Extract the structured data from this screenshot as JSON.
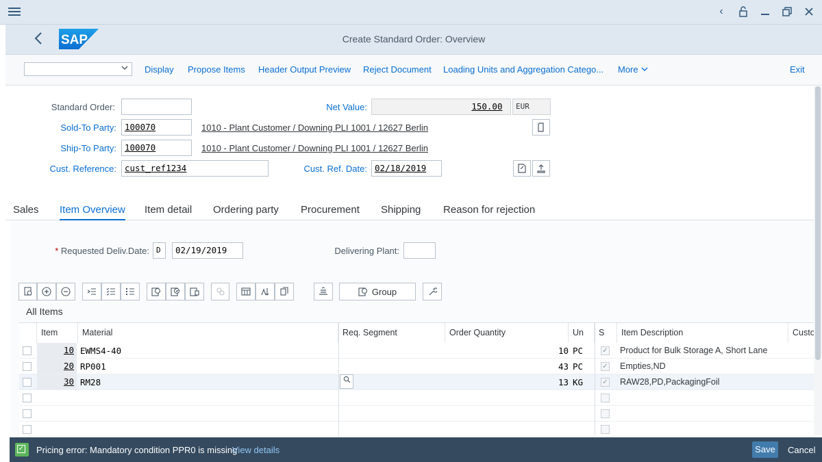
{
  "window": {
    "controls": [
      "back-icon",
      "lock-icon",
      "minimize-icon",
      "restore-icon",
      "close-icon"
    ]
  },
  "shell": {
    "logo_text": "SAP",
    "title": "Create Standard Order: Overview"
  },
  "toolbar": {
    "dropdown_value": "",
    "buttons": [
      "Display",
      "Propose Items",
      "Header Output Preview",
      "Reject Document",
      "Loading Units and Aggregation Catego...",
      "More"
    ],
    "exit_label": "Exit"
  },
  "header": {
    "standard_order": {
      "label": "Standard Order:",
      "value": ""
    },
    "sold_to": {
      "label": "Sold-To Party:",
      "value": "100070",
      "description": "1010 - Plant Customer / Downing PLI 1001 / 12627 Berlin"
    },
    "ship_to": {
      "label": "Ship-To Party:",
      "value": "100070",
      "description": "1010 - Plant Customer / Downing PLI 1001 / 12627 Berlin"
    },
    "cust_reference": {
      "label": "Cust. Reference:",
      "value": "cust_ref1234"
    },
    "net_value": {
      "label": "Net Value:",
      "value": "150.00",
      "currency": "EUR"
    },
    "cust_ref_date": {
      "label": "Cust. Ref. Date:",
      "value": "02/18/2019"
    }
  },
  "tabs": [
    "Sales",
    "Item Overview",
    "Item detail",
    "Ordering party",
    "Procurement",
    "Shipping",
    "Reason for rejection"
  ],
  "active_tab": "Item Overview",
  "item_overview": {
    "req_deliv_date_label": "Requested Deliv.Date:",
    "req_deliv_date_type": "D",
    "req_deliv_date": "02/19/2019",
    "delivering_plant_label": "Delivering Plant:",
    "delivering_plant": "",
    "group_label": "Group",
    "all_items_label": "All Items"
  },
  "table": {
    "columns": [
      "Item",
      "Material",
      "Req. Segment",
      "Order Quantity",
      "Un",
      "S",
      "Item Description",
      "Custo"
    ],
    "rows": [
      {
        "item": "10",
        "material": "EWMS4-40",
        "req_segment": "",
        "quantity": "10",
        "unit": "PC",
        "s": "✓",
        "description": "Product for Bulk Storage A, Short Lane"
      },
      {
        "item": "20",
        "material": "RP001",
        "req_segment": "",
        "quantity": "43",
        "unit": "PC",
        "s": "✓",
        "description": "Empties,ND"
      },
      {
        "item": "30",
        "material": "RM28",
        "req_segment": "",
        "quantity": "13",
        "unit": "KG",
        "s": "✓",
        "description": "RAW28,PD,PackagingFoil"
      }
    ]
  },
  "footer": {
    "message": "Pricing error: Mandatory condition PPR0 is missing",
    "view_details": "View details",
    "save_label": "Save",
    "cancel_label": "Cancel"
  },
  "colors": {
    "shell_bg": "#dfe8f1",
    "link_blue": "#0a6ed1",
    "footer_bg": "#354a5f",
    "save_bg": "#427cac",
    "success_green": "#5bb55b"
  }
}
